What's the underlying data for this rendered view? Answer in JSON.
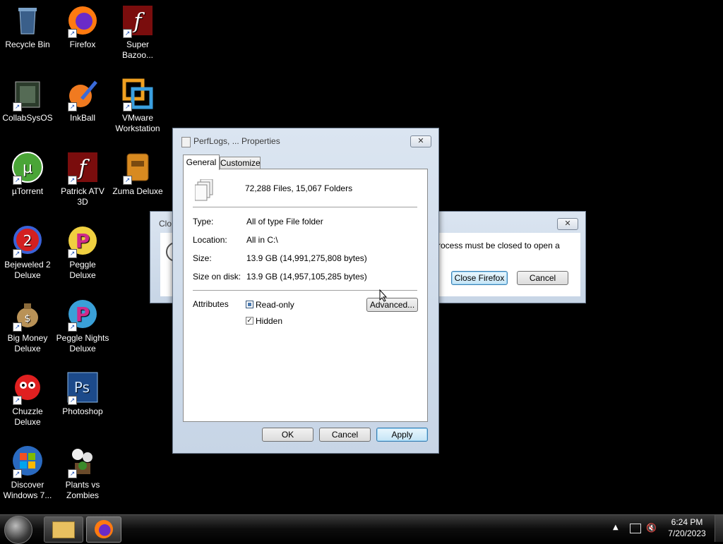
{
  "desktop_icons": [
    {
      "label": "Recycle Bin",
      "icon": "recycle-bin-icon",
      "shortcut": false
    },
    {
      "label": "Firefox",
      "icon": "firefox-icon",
      "shortcut": true
    },
    {
      "label": "Super Bazoo...",
      "icon": "flash-icon",
      "shortcut": true
    },
    {
      "label": "CollabSysOS",
      "icon": "collabsysos-icon",
      "shortcut": true
    },
    {
      "label": "InkBall",
      "icon": "inkball-icon",
      "shortcut": true
    },
    {
      "label": "VMware Workstation",
      "icon": "vmware-icon",
      "shortcut": true
    },
    {
      "label": "µTorrent",
      "icon": "utorrent-icon",
      "shortcut": true
    },
    {
      "label": "Patrick ATV 3D",
      "icon": "flash-icon",
      "shortcut": true
    },
    {
      "label": "Zuma Deluxe",
      "icon": "zuma-icon",
      "shortcut": true
    },
    {
      "label": "Bejeweled 2 Deluxe",
      "icon": "bejeweled-icon",
      "shortcut": true
    },
    {
      "label": "Peggle Deluxe",
      "icon": "peggle-icon",
      "shortcut": true
    },
    {
      "label": "Big Money Deluxe",
      "icon": "money-bag-icon",
      "shortcut": true
    },
    {
      "label": "Peggle Nights Deluxe",
      "icon": "peggle-nights-icon",
      "shortcut": true
    },
    {
      "label": "Chuzzle Deluxe",
      "icon": "chuzzle-icon",
      "shortcut": true
    },
    {
      "label": "Photoshop",
      "icon": "photoshop-icon",
      "shortcut": true
    },
    {
      "label": "Discover Windows 7...",
      "icon": "windows-logo-icon",
      "shortcut": true
    },
    {
      "label": "Plants vs Zombies",
      "icon": "plants-icon",
      "shortcut": true
    }
  ],
  "back_dialog": {
    "title_fragment": "Clo",
    "message_fragment": "rocess must be closed to open a",
    "close_firefox_label": "Close Firefox",
    "cancel_label": "Cancel"
  },
  "properties": {
    "title": "PerfLogs, ... Properties",
    "tabs": [
      {
        "label": "General",
        "active": true
      },
      {
        "label": "Customize",
        "active": false
      }
    ],
    "summary": "72,288 Files, 15,067 Folders",
    "rows": [
      {
        "label": "Type:",
        "value": "All of type File folder"
      },
      {
        "label": "Location:",
        "value": "All in C:\\"
      },
      {
        "label": "Size:",
        "value": "13.9 GB (14,991,275,808 bytes)"
      },
      {
        "label": "Size on disk:",
        "value": "13.9 GB (14,957,105,285 bytes)"
      }
    ],
    "attributes_label": "Attributes",
    "readonly_label": "Read-only",
    "hidden_label": "Hidden",
    "advanced_label": "Advanced...",
    "ok_label": "OK",
    "cancel_label": "Cancel",
    "apply_label": "Apply"
  },
  "taskbar": {
    "time": "6:24 PM",
    "date": "7/20/2023"
  }
}
